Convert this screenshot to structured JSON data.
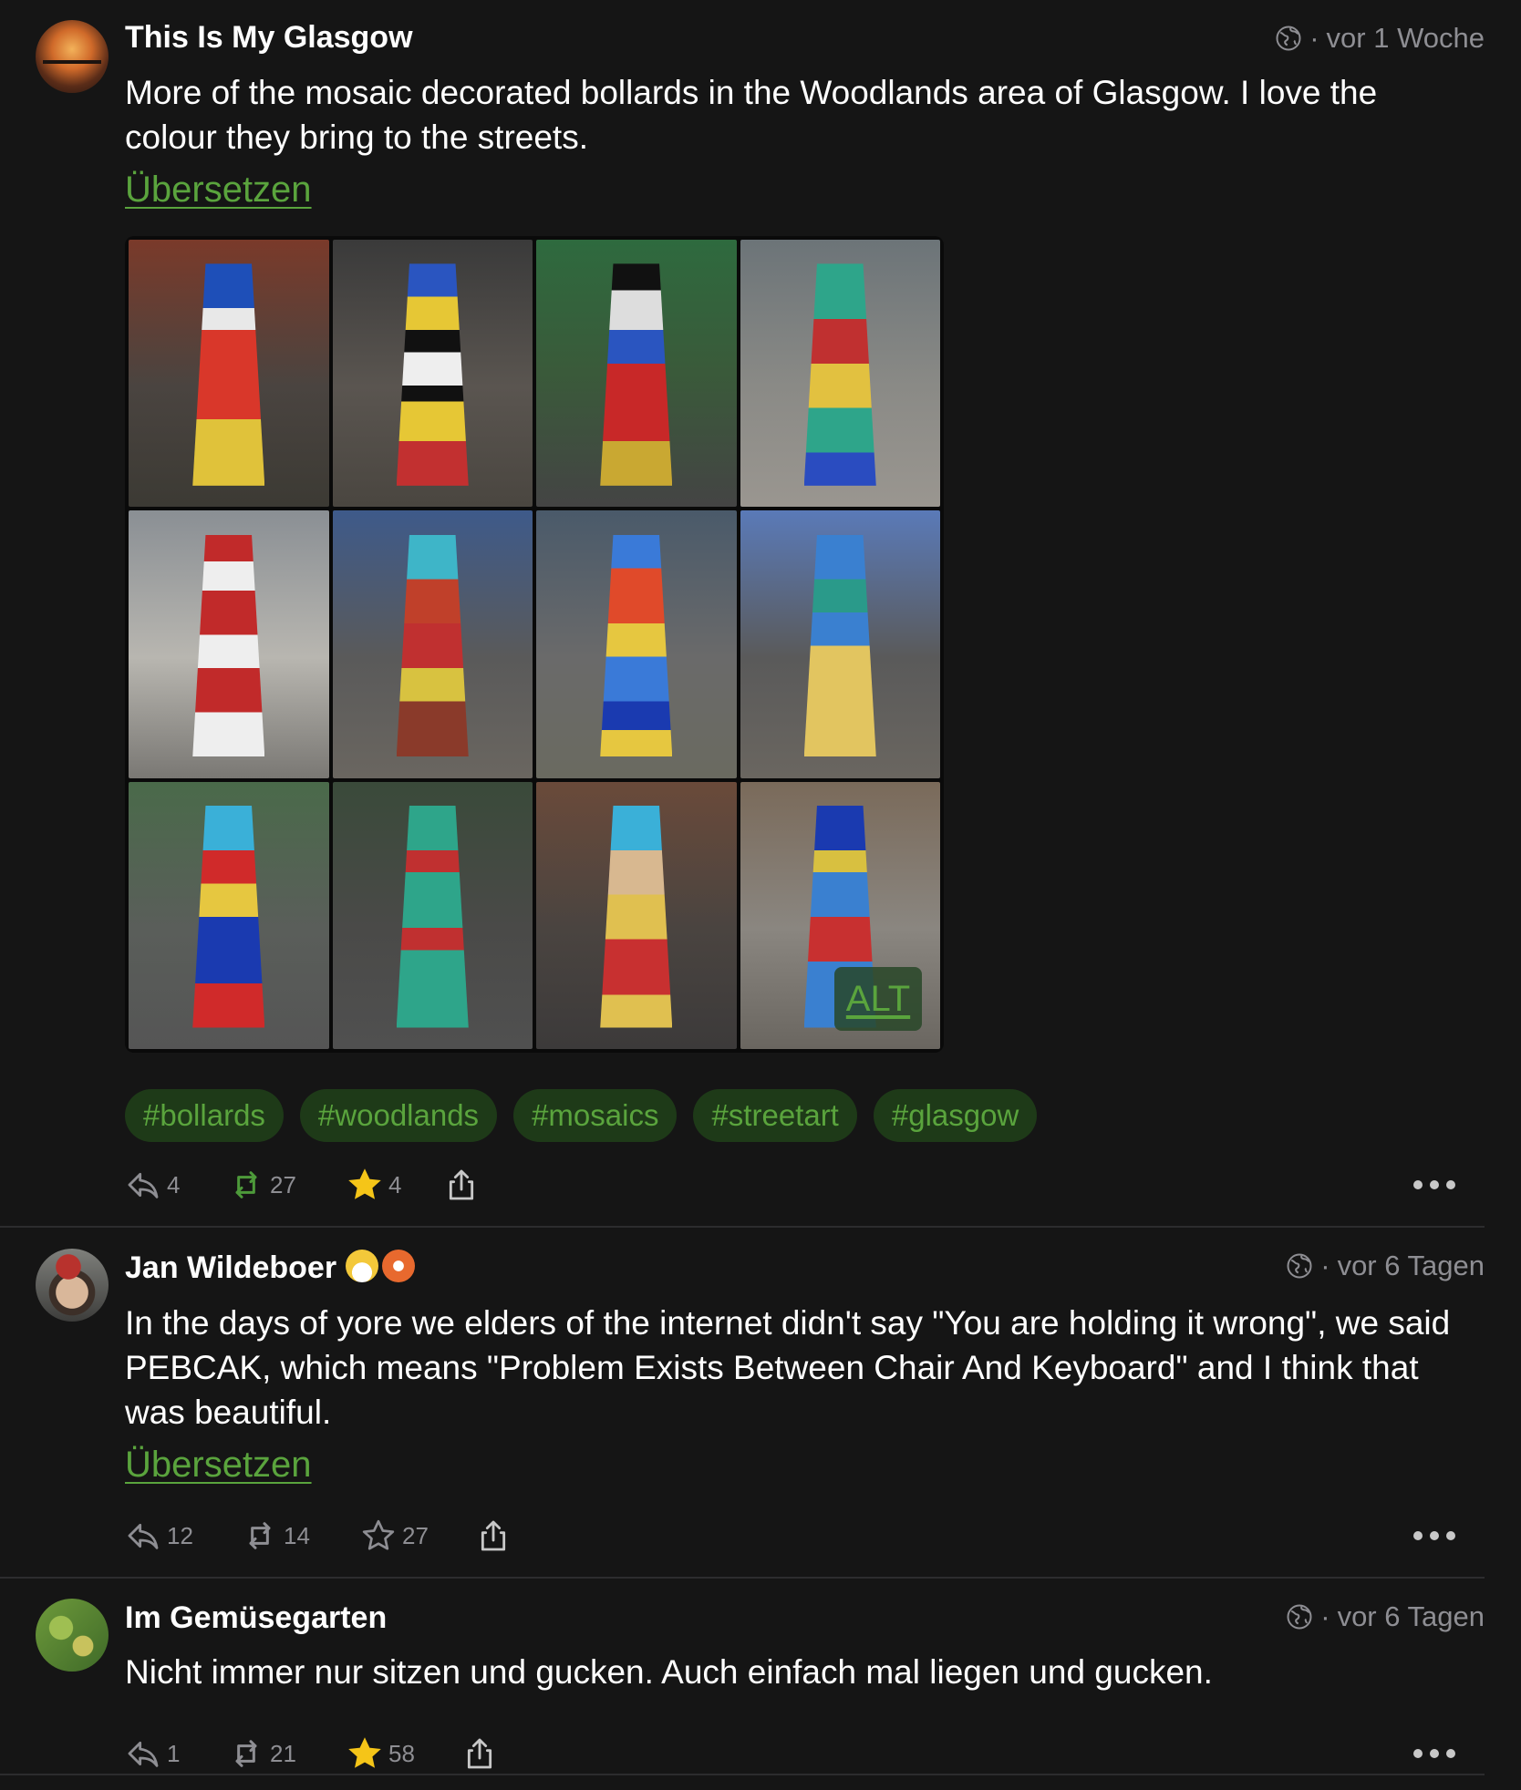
{
  "posts": [
    {
      "author": "This Is My Glasgow",
      "time": "vor 1 Woche",
      "text": "More of the mosaic decorated bollards in the Woodlands area of Glasgow. I love the colour they bring to the streets.",
      "translate": "Übersetzen",
      "alt_label": "ALT",
      "hashtags": [
        "#bollards",
        "#woodlands",
        "#mosaics",
        "#streetart",
        "#glasgow"
      ],
      "replies": "4",
      "boosts": "27",
      "favourites": "4",
      "favourited": true
    },
    {
      "author": "Jan Wildeboer",
      "time": "vor 6 Tagen",
      "text": "In the days of yore we elders of the internet didn't say \"You are holding it wrong\", we said PEBCAK, which means \"Problem Exists Between Chair And Keyboard\" and I think that was beautiful.",
      "translate": "Übersetzen",
      "replies": "12",
      "boosts": "14",
      "favourites": "27",
      "favourited": false
    },
    {
      "author": "Im Gemüsegarten",
      "time": "vor 6 Tagen",
      "text": "Nicht immer nur sitzen und gucken. Auch einfach mal liegen und gucken.",
      "replies": "1",
      "boosts": "21",
      "favourites": "58",
      "favourited": true
    }
  ],
  "icons": {
    "visibility": "globe-icon",
    "reply": "reply-icon",
    "boost": "boost-icon",
    "favourite": "star-icon",
    "share": "share-icon",
    "more": "more-icon"
  },
  "colors": {
    "background": "#151515",
    "accent_green": "#5aa43d",
    "tag_background": "#1e3a18",
    "star_active": "#f5c518",
    "muted": "#8e8e93"
  }
}
